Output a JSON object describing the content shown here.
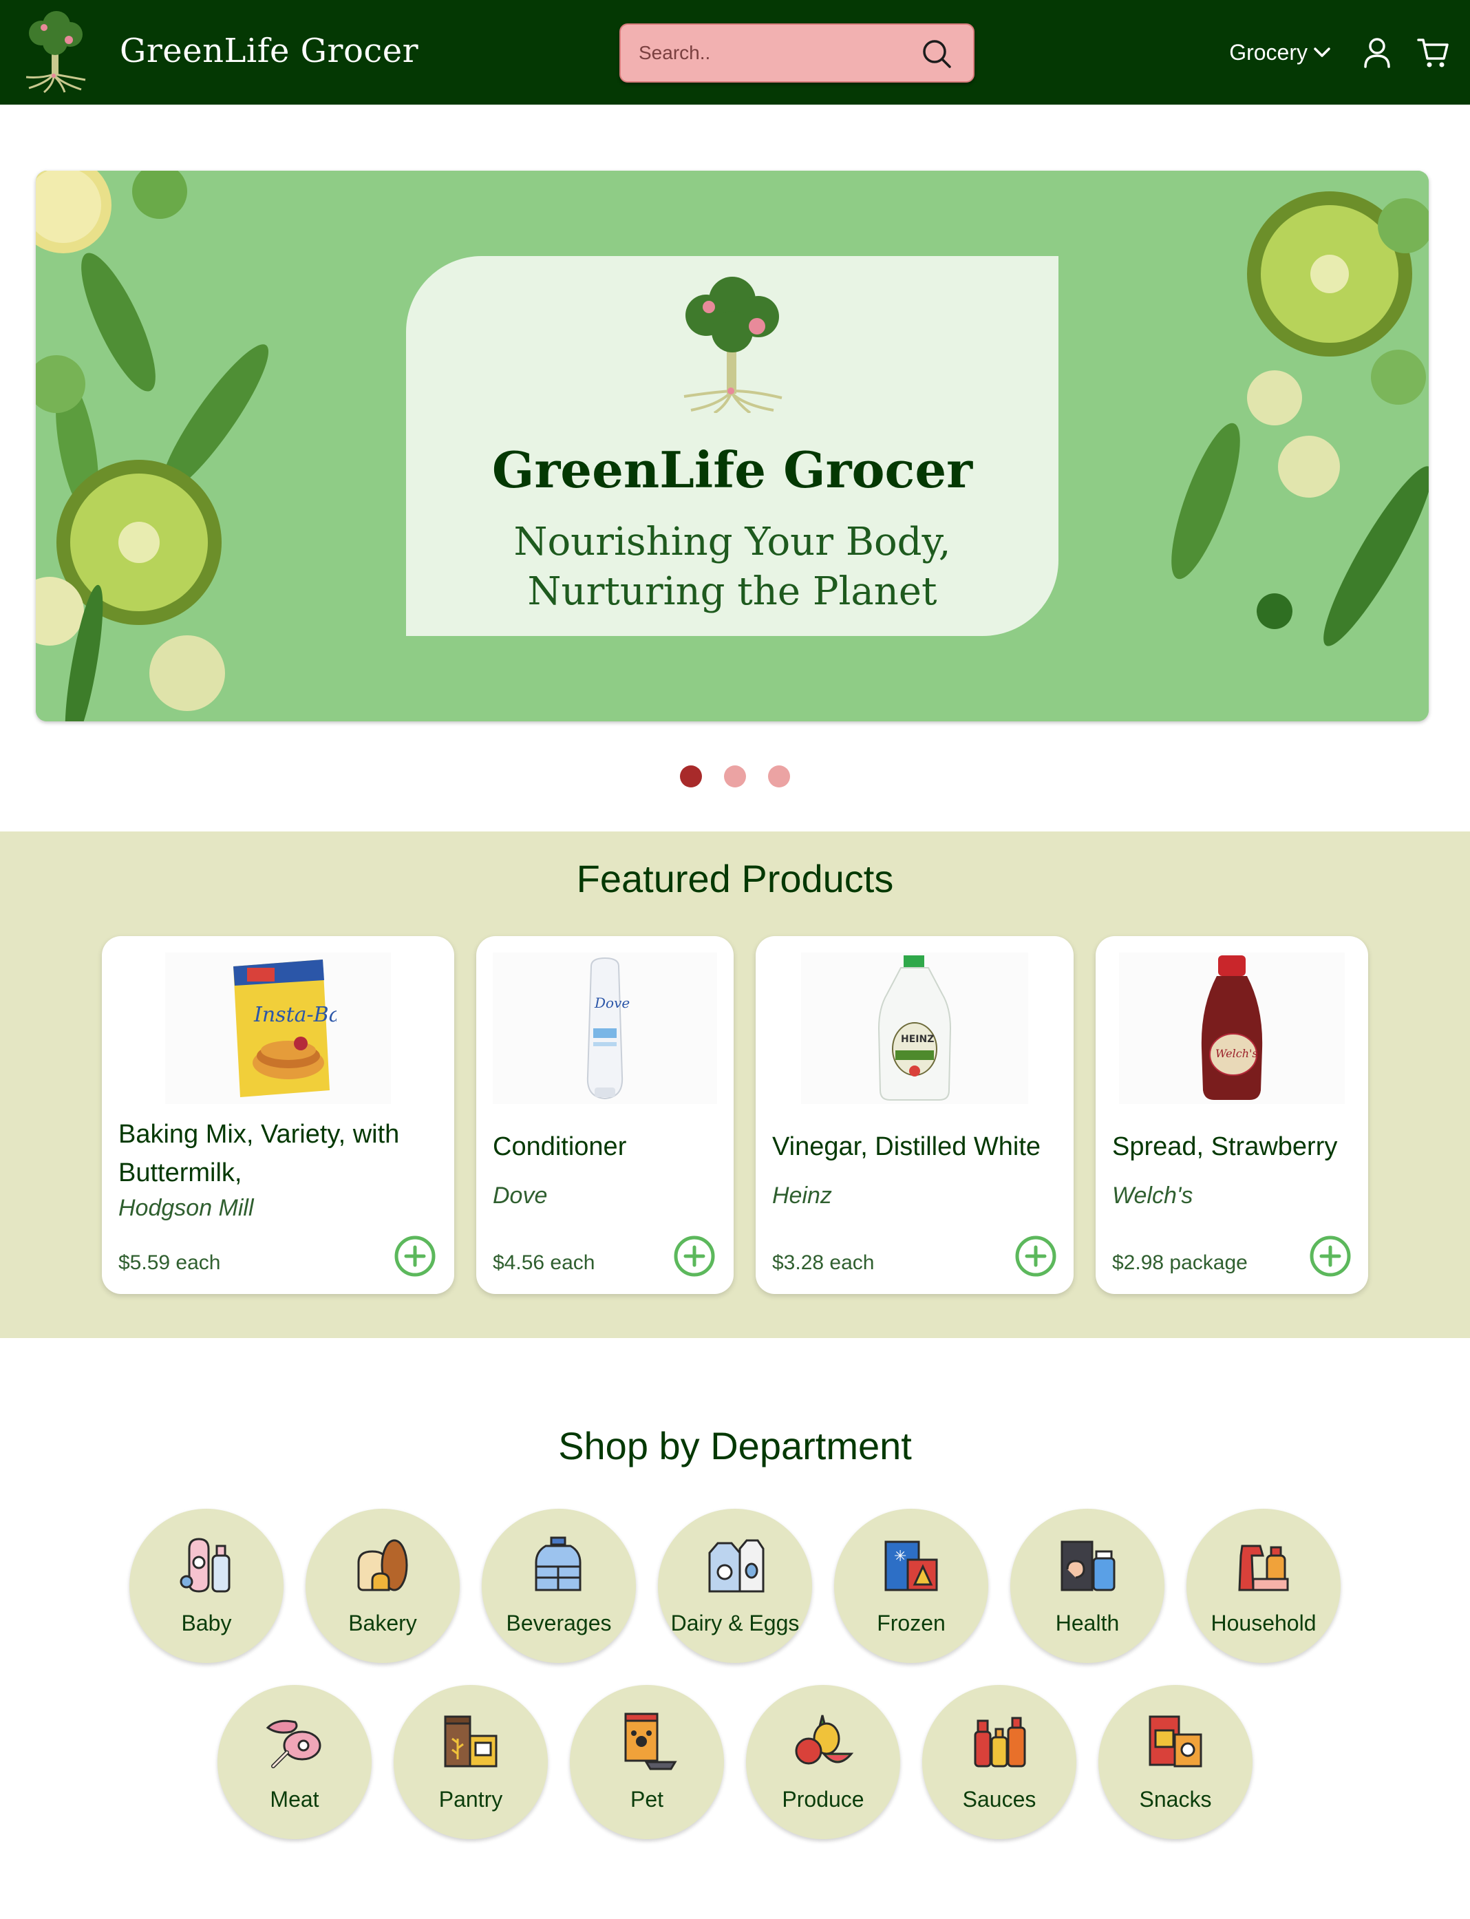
{
  "header": {
    "brand_name": "GreenLife Grocer",
    "search_placeholder": "Search..",
    "menu_label": "Grocery",
    "icons": [
      "search-icon",
      "chevron-down-icon",
      "user-icon",
      "cart-icon"
    ]
  },
  "hero": {
    "title": "GreenLife Grocer",
    "subtitle_line1": "Nourishing Your Body,",
    "subtitle_line2": "Nurturing the Planet",
    "slides": 3,
    "active_slide": 1
  },
  "featured": {
    "title": "Featured Products",
    "products": [
      {
        "name_line1": "Baking Mix, Variety, with",
        "name_line2": "Buttermilk,",
        "brand": "Hodgson Mill",
        "price": "$5.59 each"
      },
      {
        "name_line1": "Conditioner",
        "brand": "Dove",
        "price": "$4.56 each"
      },
      {
        "name_line1": "Vinegar, Distilled White",
        "brand": "Heinz",
        "price": "$3.28 each"
      },
      {
        "name_line1": "Spread, Strawberry",
        "brand": "Welch's",
        "price": "$2.98 package"
      }
    ]
  },
  "departments": {
    "title": "Shop by Department",
    "items": [
      "Baby",
      "Bakery",
      "Beverages",
      "Dairy & Eggs",
      "Frozen",
      "Health",
      "Household",
      "Meat",
      "Pantry",
      "Pet",
      "Produce",
      "Sauces",
      "Snacks"
    ]
  },
  "colors": {
    "nav_bg": "#043803",
    "search_bg": "#f2b1b1",
    "hero_bg": "#8ecb85",
    "section_bg": "#e4e6c3",
    "dot_active": "#a82a2a",
    "dot_inactive": "#eba3a3",
    "accent_green": "#5cb85c"
  }
}
